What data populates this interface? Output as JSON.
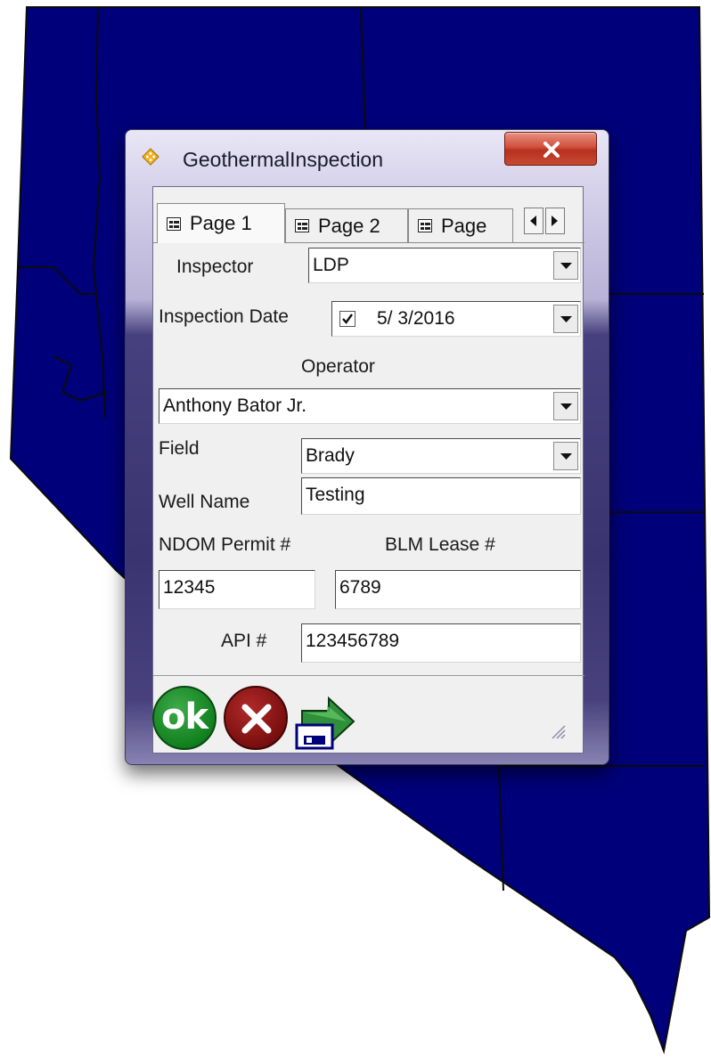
{
  "window": {
    "title": "GeothermalInspection",
    "close_label": "X"
  },
  "tabs": [
    {
      "label": "Page 1"
    },
    {
      "label": "Page 2"
    },
    {
      "label": "Page"
    }
  ],
  "form": {
    "inspector": {
      "label": "Inspector",
      "value": "LDP"
    },
    "inspection_date": {
      "label": "Inspection Date",
      "value": "5/  3/2016"
    },
    "operator": {
      "label": "Operator",
      "value": "Anthony Bator Jr."
    },
    "field": {
      "label": "Field",
      "value": "Brady"
    },
    "well_name": {
      "label": "Well Name",
      "value": "Testing"
    },
    "ndom_permit": {
      "label": "NDOM Permit #",
      "value": "12345"
    },
    "blm_lease": {
      "label": "BLM Lease #",
      "value": "6789"
    },
    "api": {
      "label": "API #",
      "value": "123456789"
    }
  },
  "buttons": {
    "ok_label": "ok"
  },
  "colors": {
    "map_fill": "#00007a",
    "map_border": "#0b0b0b"
  }
}
